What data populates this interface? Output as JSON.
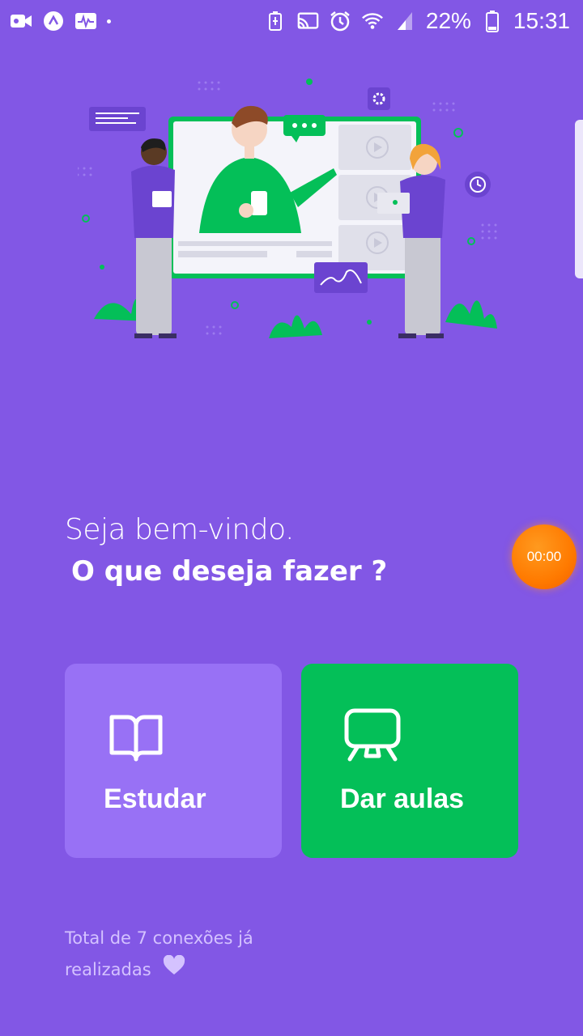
{
  "status_bar": {
    "battery": "22%",
    "time": "15:31",
    "left_icons": [
      "video-camera-icon",
      "app-logo-icon",
      "activity-monitor-icon"
    ],
    "right_icons": [
      "battery-saver-icon",
      "cast-icon",
      "alarm-icon",
      "wifi-icon",
      "signal-icon",
      "battery-icon"
    ]
  },
  "greeting": {
    "line1": "Seja bem-vindo.",
    "line2": "O que deseja fazer ?"
  },
  "timer": {
    "label": "00:00"
  },
  "actions": {
    "study": {
      "label": "Estudar",
      "icon": "book-open-icon",
      "color": "#9871F5"
    },
    "teach": {
      "label": "Dar aulas",
      "icon": "presentation-board-icon",
      "color": "#04BF58"
    }
  },
  "footer": {
    "line1": "Total de 7 conexões já",
    "line2": "realizadas"
  },
  "colors": {
    "background": "#8257E5",
    "primary_light": "#9871F5",
    "secondary": "#04BF58",
    "footer_text": "#D4C2FF"
  }
}
